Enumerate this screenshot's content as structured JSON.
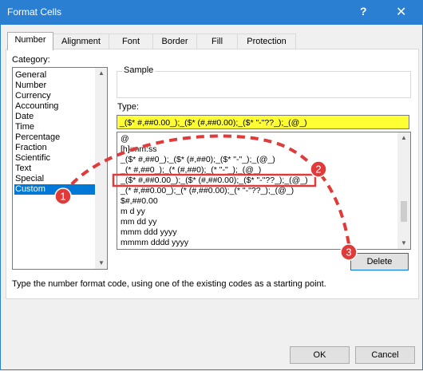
{
  "window": {
    "title": "Format Cells",
    "help_label": "?",
    "close_label": "✕"
  },
  "tabs": [
    {
      "label": "Number",
      "active": true
    },
    {
      "label": "Alignment",
      "active": false
    },
    {
      "label": "Font",
      "active": false
    },
    {
      "label": "Border",
      "active": false
    },
    {
      "label": "Fill",
      "active": false
    },
    {
      "label": "Protection",
      "active": false
    }
  ],
  "category": {
    "label": "Category:",
    "items": [
      "General",
      "Number",
      "Currency",
      "Accounting",
      "Date",
      "Time",
      "Percentage",
      "Fraction",
      "Scientific",
      "Text",
      "Special",
      "Custom"
    ],
    "selected": "Custom"
  },
  "sample": {
    "label": "Sample",
    "value": ""
  },
  "type": {
    "label": "Type:",
    "value": "_($* #,##0.00_);_($* (#,##0.00);_($* \"-\"??_);_(@_)"
  },
  "formats": [
    "@",
    "[h]:mm:ss",
    "_($* #,##0_);_($* (#,##0);_($* \"-\"_);_(@_)",
    "_(* #,##0_);_(* (#,##0);_(* \"-\"_);_(@_)",
    "_($* #,##0.00_);_($* (#,##0.00);_($* \"-\"??_);_(@_)",
    "_(* #,##0.00_);_(* (#,##0.00);_(* \"-\"??_);_(@_)",
    "$#,##0.00",
    "m d yy",
    "mm dd yy",
    "mmm ddd yyyy",
    "mmmm dddd yyyy"
  ],
  "delete_label": "Delete",
  "hint": "Type the number format code, using one of the existing codes as a starting point.",
  "ok_label": "OK",
  "cancel_label": "Cancel",
  "annotations": {
    "badges": [
      "1",
      "2",
      "3"
    ],
    "color": "#e03a3a"
  }
}
